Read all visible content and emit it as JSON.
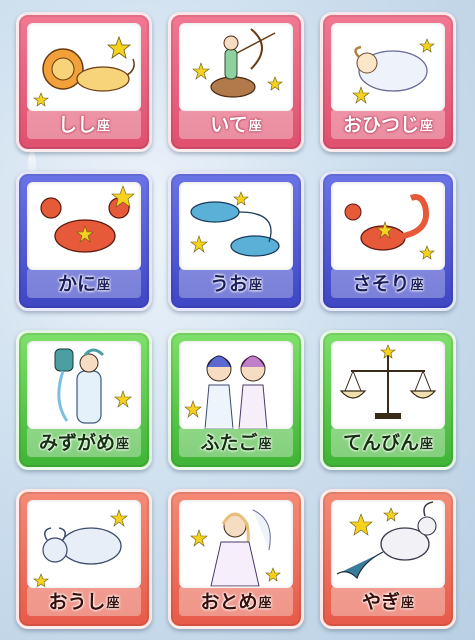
{
  "tiles": [
    {
      "name": "しし",
      "suffix": "座",
      "theme": "pink",
      "icon": "leo-lion-icon"
    },
    {
      "name": "いて",
      "suffix": "座",
      "theme": "pink",
      "icon": "sagittarius-archer-icon"
    },
    {
      "name": "おひつじ",
      "suffix": "座",
      "theme": "pink",
      "icon": "aries-ram-icon"
    },
    {
      "name": "かに",
      "suffix": "座",
      "theme": "blue",
      "icon": "cancer-crab-icon"
    },
    {
      "name": "うお",
      "suffix": "座",
      "theme": "blue",
      "icon": "pisces-fish-icon"
    },
    {
      "name": "さそり",
      "suffix": "座",
      "theme": "blue",
      "icon": "scorpio-scorpion-icon"
    },
    {
      "name": "みずがめ",
      "suffix": "座",
      "theme": "green",
      "icon": "aquarius-water-bearer-icon"
    },
    {
      "name": "ふたご",
      "suffix": "座",
      "theme": "green",
      "icon": "gemini-twins-icon"
    },
    {
      "name": "てんびん",
      "suffix": "座",
      "theme": "green",
      "icon": "libra-scales-icon"
    },
    {
      "name": "おうし",
      "suffix": "座",
      "theme": "coral",
      "icon": "taurus-bull-icon"
    },
    {
      "name": "おとめ",
      "suffix": "座",
      "theme": "coral",
      "icon": "virgo-maiden-icon"
    },
    {
      "name": "やぎ",
      "suffix": "座",
      "theme": "coral",
      "icon": "capricorn-goat-icon"
    }
  ],
  "colors": {
    "pink": "#e65a78",
    "blue": "#4a52d0",
    "green": "#52c444",
    "coral": "#ea6a55",
    "star": "#f6d21e"
  }
}
